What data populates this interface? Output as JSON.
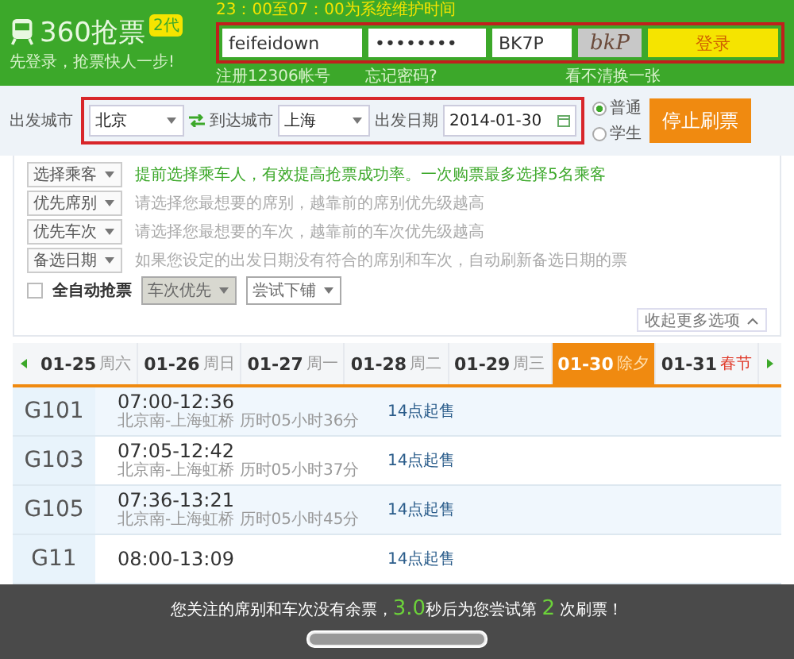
{
  "header": {
    "logo": "360抢票",
    "badge": "2代",
    "slogan": "先登录，抢票快人一步!",
    "notice": "23：00至07：00为系统维护时间",
    "login": {
      "username": "feifeidown",
      "password": "••••••••",
      "captcha": "BK7P",
      "captcha_image": "bkP",
      "button": "登录",
      "register_link": "注册12306帐号",
      "forgot_link": "忘记密码?",
      "refresh_link": "看不清换一张"
    }
  },
  "search": {
    "from_label": "出发城市",
    "from": "北京",
    "to_label": "到达城市",
    "to": "上海",
    "date_label": "出发日期",
    "date": "2014-01-30",
    "ticket_types": [
      {
        "label": "普通",
        "selected": true
      },
      {
        "label": "学生",
        "selected": false
      }
    ],
    "button": "停止刷票"
  },
  "options": [
    {
      "label": "选择乘客",
      "hint": "提前选择乘车人，有效提高抢票成功率。一次购票最多选择5名乘客",
      "kind": "highlight"
    },
    {
      "label": "优先席别",
      "hint": "请选择您最想要的席别，越靠前的席别优先级越高",
      "kind": "plain"
    },
    {
      "label": "优先车次",
      "hint": "请选择您最想要的车次，越靠前的车次优先级越高",
      "kind": "plain"
    },
    {
      "label": "备选日期",
      "hint": "如果您设定的出发日期没有符合的席别和车次，自动刷新备选日期的票",
      "kind": "plain"
    }
  ],
  "auto": {
    "label": "全自动抢票",
    "checked": false,
    "priority": "车次优先",
    "berth": "尝试下铺"
  },
  "collapse": "收起更多选项",
  "dates": [
    {
      "date": "01-25",
      "day": "周六",
      "selected": false,
      "holiday": false
    },
    {
      "date": "01-26",
      "day": "周日",
      "selected": false,
      "holiday": false
    },
    {
      "date": "01-27",
      "day": "周一",
      "selected": false,
      "holiday": false
    },
    {
      "date": "01-28",
      "day": "周二",
      "selected": false,
      "holiday": false
    },
    {
      "date": "01-29",
      "day": "周三",
      "selected": false,
      "holiday": false
    },
    {
      "date": "01-30",
      "day": "除夕",
      "selected": true,
      "holiday": false
    },
    {
      "date": "01-31",
      "day": "春节",
      "selected": false,
      "holiday": true
    }
  ],
  "trains": [
    {
      "number": "G101",
      "time": "07:00-12:36",
      "route": "北京南-上海虹桥 历时05小时36分",
      "status": "14点起售"
    },
    {
      "number": "G103",
      "time": "07:05-12:42",
      "route": "北京南-上海虹桥 历时05小时37分",
      "status": "14点起售"
    },
    {
      "number": "G105",
      "time": "07:36-13:21",
      "route": "北京南-上海虹桥 历时05小时45分",
      "status": "14点起售"
    },
    {
      "number": "G11",
      "time": "08:00-13:09",
      "status": "14点起售"
    }
  ],
  "overlay": {
    "message": [
      {
        "text": "您关注的席别和车次没有余票，",
        "highlight": false
      },
      {
        "text": "3.0",
        "highlight": true
      },
      {
        "text": "秒后为您尝试第 ",
        "highlight": false
      },
      {
        "text": "2",
        "highlight": true
      },
      {
        "text": " 次刷票！",
        "highlight": false
      }
    ],
    "level": 1
  }
}
